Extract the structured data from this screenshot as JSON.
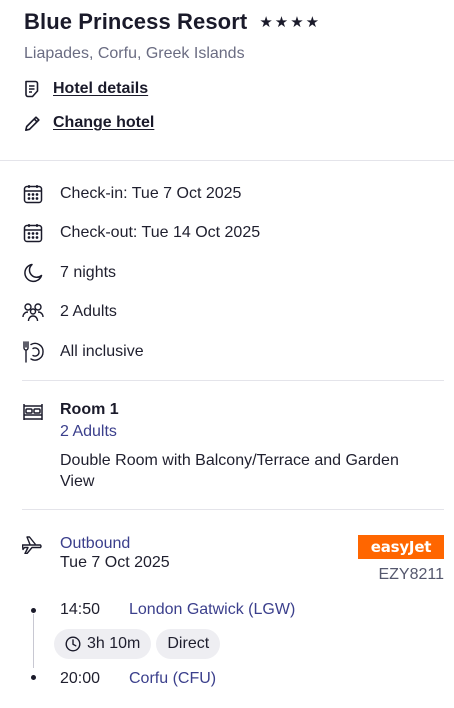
{
  "hotel": {
    "name": "Blue Princess Resort",
    "star_rating": 4,
    "stars": [
      "★",
      "★",
      "★",
      "★"
    ],
    "location": "Liapades, Corfu, Greek Islands",
    "details_link": "Hotel details",
    "change_link": "Change hotel"
  },
  "booking": {
    "check_in": "Check-in: Tue 7 Oct 2025",
    "check_out": "Check-out: Tue 14 Oct 2025",
    "nights": "7 nights",
    "guests": "2 Adults",
    "board": "All inclusive"
  },
  "room": {
    "title": "Room 1",
    "guests": "2 Adults",
    "type": "Double Room with Balcony/Terrace and Garden View"
  },
  "flight": {
    "direction": "Outbound",
    "date": "Tue 7 Oct 2025",
    "airline": "easyJet",
    "airline_color": "#ff6600",
    "flight_number": "EZY8211",
    "departure_time": "14:50",
    "departure_place": "London Gatwick (LGW)",
    "duration": "3h 10m",
    "stops": "Direct",
    "arrival_time": "20:00",
    "arrival_place": "Corfu (CFU)"
  },
  "icons": {
    "hotel_details": "document-icon",
    "change_hotel": "pencil-icon",
    "check_in": "calendar-icon",
    "check_out": "calendar-icon",
    "nights": "moon-icon",
    "guests": "people-icon",
    "board": "cutlery-icon",
    "room": "bed-icon",
    "flight": "plane-icon",
    "duration": "clock-icon"
  }
}
